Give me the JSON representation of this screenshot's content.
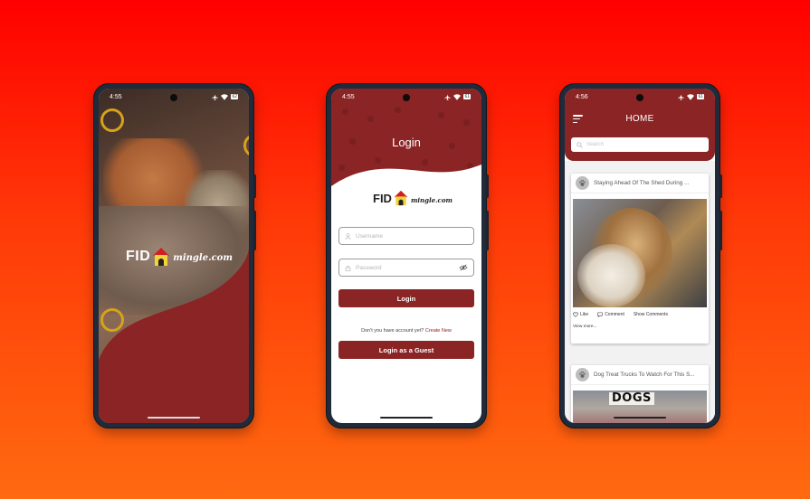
{
  "colors": {
    "brand_red": "#8b2424",
    "background_top": "#ff0000",
    "background_bottom": "#ff6a10"
  },
  "splash": {
    "status_time": "4:55",
    "battery": "62",
    "logo_fid": "FID",
    "logo_rest": "mingle.com"
  },
  "login": {
    "status_time": "4:55",
    "battery": "61",
    "title": "Login",
    "logo_fid": "FID",
    "logo_rest": "mingle.com",
    "username_placeholder": "Username",
    "password_placeholder": "Password",
    "login_button": "Login",
    "no_account_text": "Don't you have account yet?",
    "create_new_link": "Create New",
    "guest_button": "Login as a Guest"
  },
  "home": {
    "status_time": "4:56",
    "battery": "61",
    "title": "HOME",
    "search_placeholder": "Search",
    "posts": [
      {
        "title": "Staying Ahead Of The Shed During ...",
        "like_label": "Like",
        "comment_label": "Comment",
        "show_comments_label": "Show Comments",
        "view_more": "View more..."
      },
      {
        "title": "Dog Treat Trucks To Watch For This S...",
        "image_sign": "DOGS"
      }
    ]
  }
}
